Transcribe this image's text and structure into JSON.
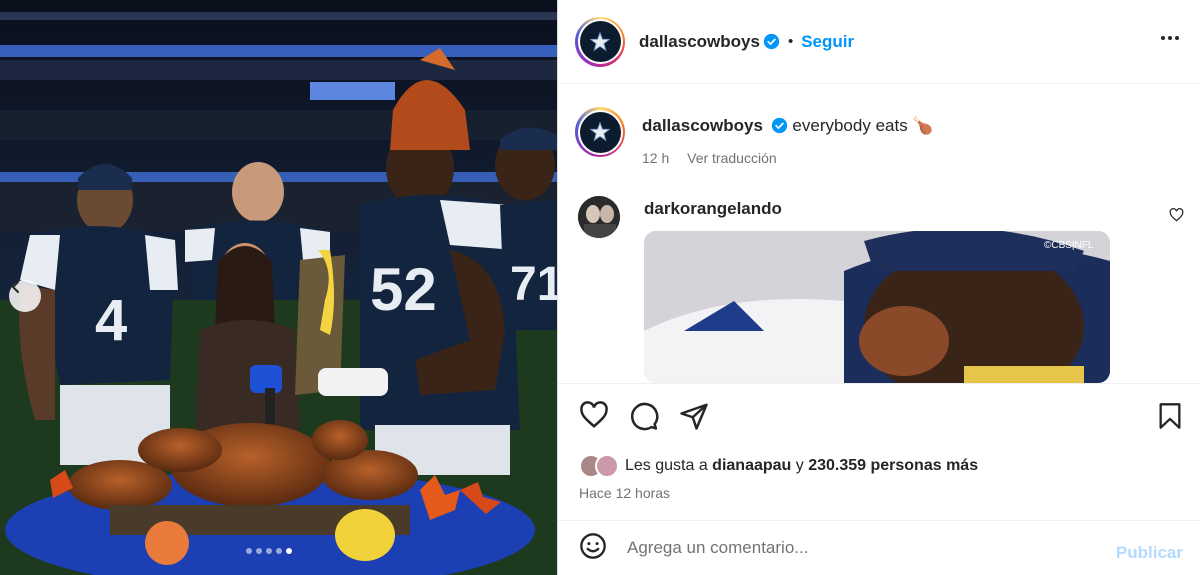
{
  "post": {
    "username": "dallascowboys",
    "follow_label": "Seguir",
    "separator": "•",
    "caption_text": "everybody eats 🍗",
    "time_ago": "12 h",
    "translate_label": "Ver traducción",
    "carousel_count": 5,
    "carousel_active": 4
  },
  "comment": {
    "username": "darkorangelando",
    "gif_watermark": "©CBS|NFL"
  },
  "likes": {
    "prefix": "Les gusta a ",
    "first_user": "dianaapau",
    "middle": " y ",
    "count_text": "230.359 personas más"
  },
  "timestamp": "Hace 12 horas",
  "add_comment": {
    "placeholder": "Agrega un comentario...",
    "publish_label": "Publicar"
  },
  "photo": {
    "jersey_numbers": [
      "4",
      "52",
      "71"
    ]
  },
  "colors": {
    "link": "#0095f6",
    "publish_disabled": "#b3dbff",
    "secondary_text": "#737373",
    "verified": "#0095f6",
    "navy": "#0d1b2e"
  },
  "icons": {
    "heart": "heart-icon",
    "comment": "comment-icon",
    "share": "share-icon",
    "bookmark": "bookmark-icon",
    "emoji": "emoji-icon",
    "more": "more-options-icon",
    "verified": "verified-badge-icon",
    "prev": "chevron-left-icon"
  }
}
